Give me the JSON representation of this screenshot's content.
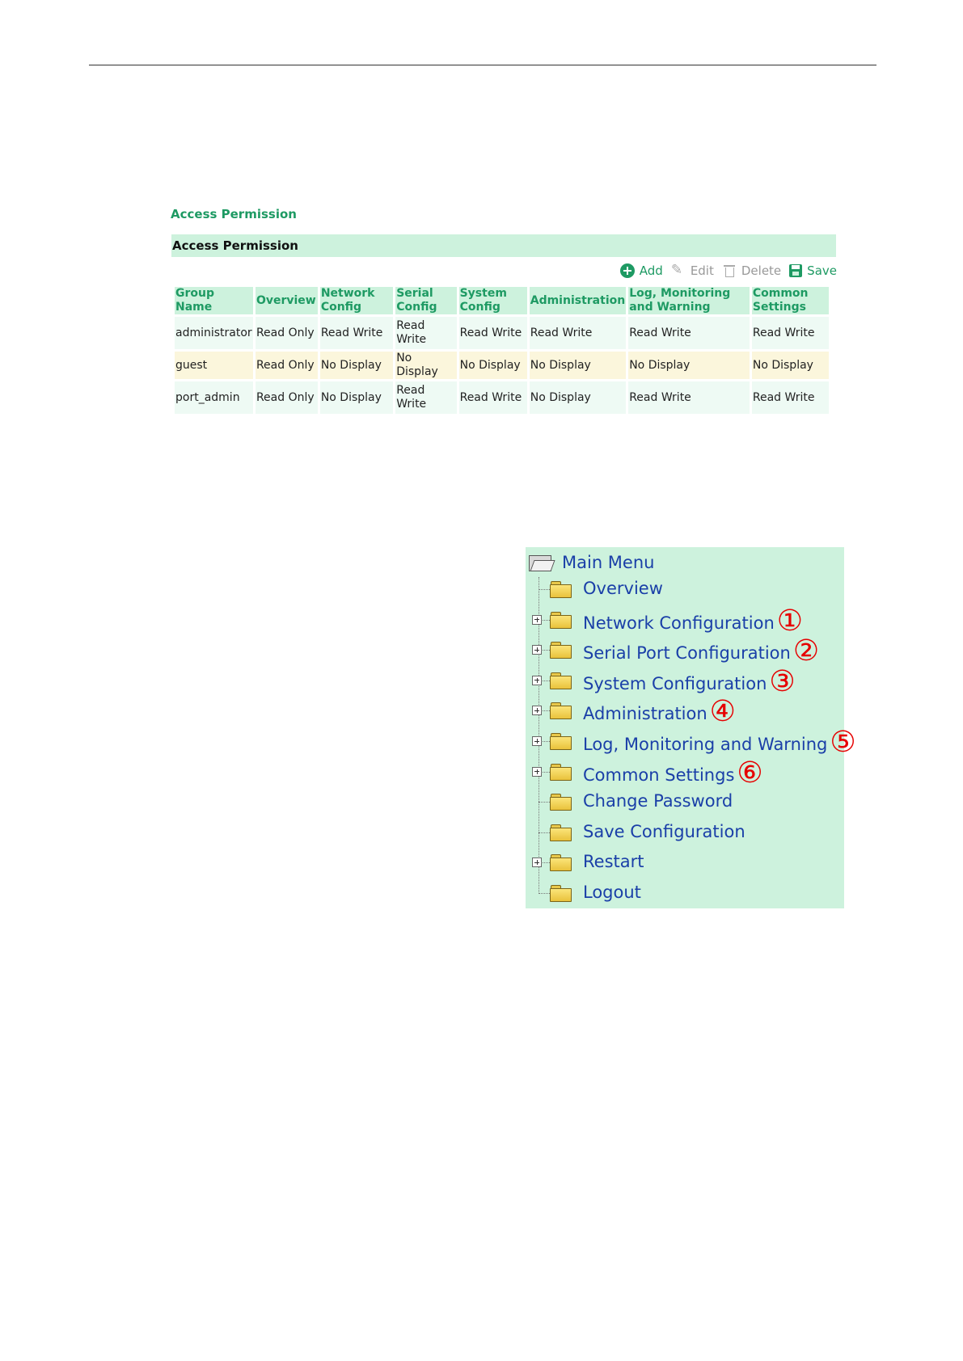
{
  "access_permission": {
    "title": "Access Permission",
    "bar_title": "Access Permission",
    "toolbar": {
      "add": "Add",
      "edit": "Edit",
      "delete": "Delete",
      "save": "Save"
    },
    "columns": [
      "Group\nName",
      "Overview",
      "Network\nConfig",
      "Serial\nConfig",
      "System\nConfig",
      "Administration",
      "Log, Monitoring\nand Warning",
      "Common\nSettings"
    ],
    "rows": [
      [
        "administrator",
        "Read Only",
        "Read Write",
        "Read\nWrite",
        "Read Write",
        "Read Write",
        "Read Write",
        "Read Write"
      ],
      [
        "guest",
        "Read Only",
        "No Display",
        "No Display",
        "No Display",
        "No Display",
        "No Display",
        "No Display"
      ],
      [
        "port_admin",
        "Read Only",
        "No Display",
        "Read\nWrite",
        "Read Write",
        "No Display",
        "Read Write",
        "Read Write"
      ]
    ]
  },
  "main_menu": {
    "title": "Main Menu",
    "items": [
      {
        "label": "Overview",
        "expandable": false,
        "marker": ""
      },
      {
        "label": "Network Configuration",
        "expandable": true,
        "marker": "①"
      },
      {
        "label": "Serial Port Configuration",
        "expandable": true,
        "marker": "②"
      },
      {
        "label": "System Configuration",
        "expandable": true,
        "marker": "③"
      },
      {
        "label": "Administration",
        "expandable": true,
        "marker": "④"
      },
      {
        "label": "Log, Monitoring and Warning",
        "expandable": true,
        "marker": "⑤"
      },
      {
        "label": "Common Settings",
        "expandable": true,
        "marker": "⑥"
      },
      {
        "label": "Change Password",
        "expandable": false,
        "marker": ""
      },
      {
        "label": "Save Configuration",
        "expandable": false,
        "marker": ""
      },
      {
        "label": "Restart",
        "expandable": true,
        "marker": ""
      },
      {
        "label": "Logout",
        "expandable": false,
        "marker": ""
      }
    ]
  },
  "colors": {
    "accent_green": "#1e9a63",
    "panel_green": "#cdf2dd",
    "menu_link_blue": "#1a3fa8",
    "marker_red": "#e60000"
  }
}
